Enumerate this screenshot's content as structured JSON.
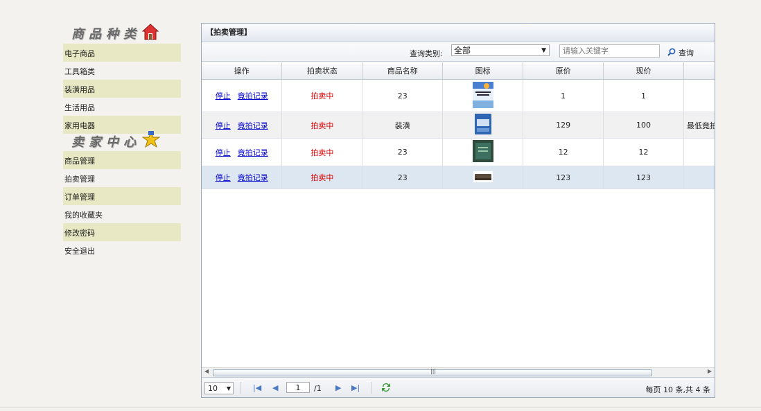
{
  "sidebar": {
    "section1_title": "商品种类",
    "section1_items": [
      "电子商品",
      "工具箱类",
      "装潢用品",
      "生活用品",
      "家用电器"
    ],
    "section2_title": "卖家中心",
    "section2_items": [
      "商品管理",
      "拍卖管理",
      "订单管理",
      "我的收藏夹",
      "修改密码",
      "安全退出"
    ]
  },
  "panel": {
    "title": "【拍卖管理】",
    "search_label": "查询类别:",
    "category_selected": "全部",
    "keyword_placeholder": "请输入关键字",
    "search_button": "查询"
  },
  "table": {
    "columns": [
      "操作",
      "拍卖状态",
      "商品名称",
      "图标",
      "原价",
      "现价",
      ""
    ],
    "rows": [
      {
        "op_stop": "停止",
        "op_record": "竟拍记录",
        "status": "拍卖中",
        "name": "23",
        "icon": "book-cover-icon",
        "orig": "1",
        "now": "1",
        "extra": ""
      },
      {
        "op_stop": "停止",
        "op_record": "竟拍记录",
        "status": "拍卖中",
        "name": "装潢",
        "icon": "blue-box-icon",
        "orig": "129",
        "now": "100",
        "extra": "最低竟拍"
      },
      {
        "op_stop": "停止",
        "op_record": "竟拍记录",
        "status": "拍卖中",
        "name": "23",
        "icon": "green-book-icon",
        "orig": "12",
        "now": "12",
        "extra": ""
      },
      {
        "op_stop": "停止",
        "op_record": "竟拍记录",
        "status": "拍卖中",
        "name": "23",
        "icon": "sofa-icon",
        "orig": "123",
        "now": "123",
        "extra": ""
      }
    ]
  },
  "pager": {
    "page_size": "10",
    "page": "1",
    "total_pages": "/1",
    "info": "每页 10 条,共 4 条"
  },
  "colors": {
    "status_red": "#dd0000",
    "link_blue": "#0000cc",
    "sidebar_band": "#e8e8c4"
  }
}
